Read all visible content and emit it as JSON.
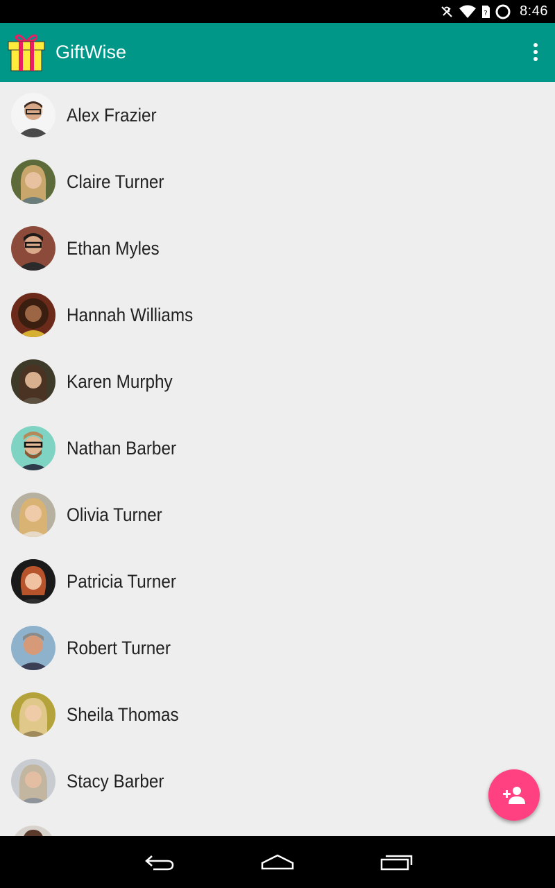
{
  "status_bar": {
    "time": "8:46"
  },
  "app_bar": {
    "title": "GiftWise"
  },
  "contacts": [
    {
      "name": "Alex Frazier"
    },
    {
      "name": "Claire Turner"
    },
    {
      "name": "Ethan Myles"
    },
    {
      "name": "Hannah Williams"
    },
    {
      "name": "Karen Murphy"
    },
    {
      "name": "Nathan Barber"
    },
    {
      "name": "Olivia Turner"
    },
    {
      "name": "Patricia Turner"
    },
    {
      "name": "Robert Turner"
    },
    {
      "name": "Sheila Thomas"
    },
    {
      "name": "Stacy Barber"
    }
  ],
  "colors": {
    "primary": "#009688",
    "accent": "#ff4081",
    "background": "#eeeeee"
  },
  "icons": {
    "fab": "add-person-icon",
    "overflow": "more-vert-icon"
  }
}
